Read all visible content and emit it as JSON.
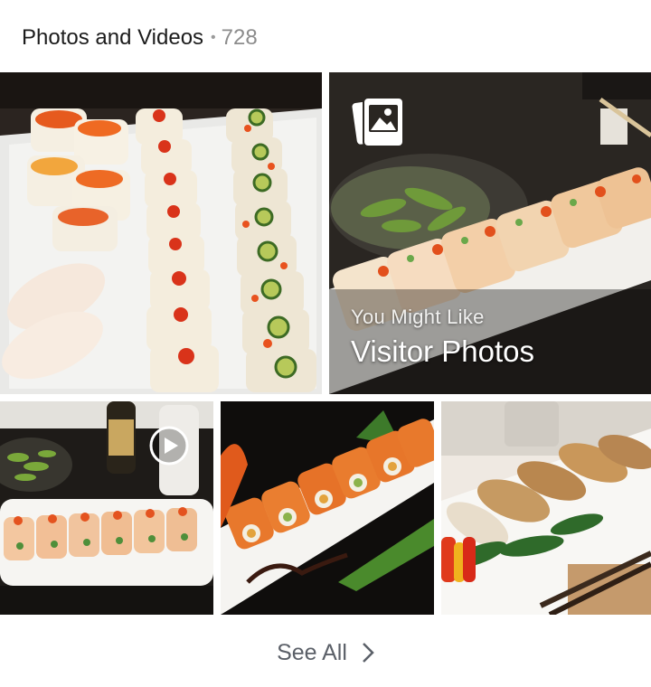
{
  "section": {
    "title": "Photos and Videos",
    "separator": "•",
    "count": "728"
  },
  "tiles": [
    {
      "kind": "photo",
      "subject": "sushi rolls and nigiri on white plate"
    },
    {
      "kind": "album",
      "subject": "sushi roll with edamame",
      "overlay_subtitle": "You Might Like",
      "overlay_title": "Visitor Photos",
      "icon": "photo-album-icon"
    },
    {
      "kind": "video",
      "subject": "sushi roll with edamame and beer",
      "icon": "play-icon"
    },
    {
      "kind": "photo",
      "subject": "shrimp tempura sushi roll"
    },
    {
      "kind": "photo",
      "subject": "gyoza dumplings"
    }
  ],
  "footer": {
    "see_all_label": "See All",
    "icon": "chevron-right-icon"
  }
}
